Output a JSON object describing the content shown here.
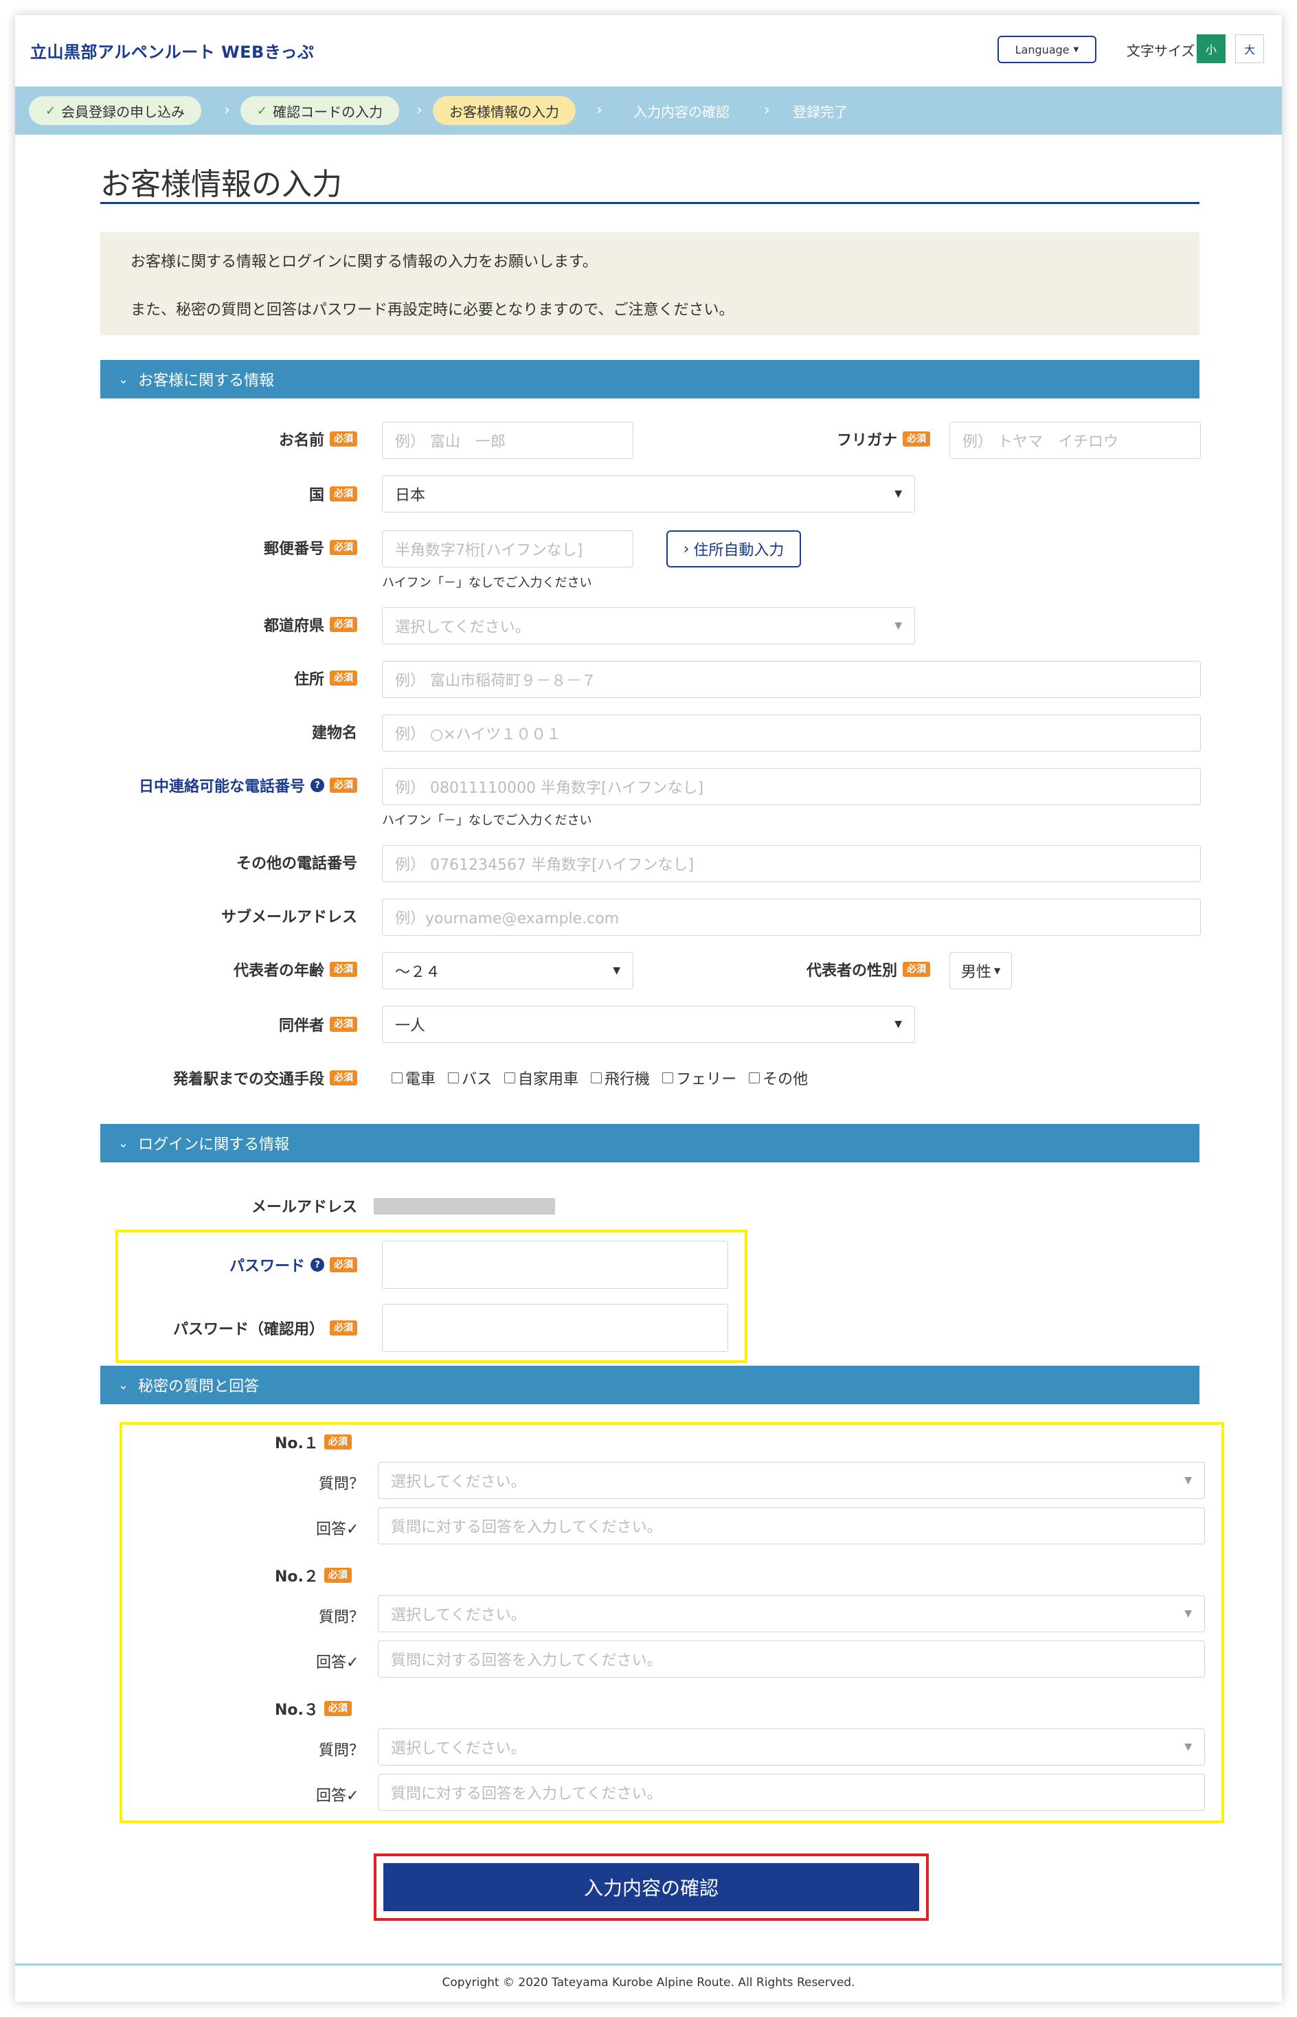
{
  "header": {
    "brand": "立山黒部アルペンルート WEBきっぷ",
    "language": "Language",
    "font_size_label": "文字サイズ",
    "font_small": "小",
    "font_large": "大"
  },
  "steps": [
    {
      "label": "会員登録の申し込み",
      "state": "done"
    },
    {
      "label": "確認コードの入力",
      "state": "done"
    },
    {
      "label": "お客様情報の入力",
      "state": "current"
    },
    {
      "label": "入力内容の確認",
      "state": "todo"
    },
    {
      "label": "登録完了",
      "state": "todo"
    }
  ],
  "page_title": "お客様情報の入力",
  "notice": {
    "line1": "お客様に関する情報とログインに関する情報の入力をお願いします。",
    "line2": "また、秘密の質問と回答はパスワード再設定時に必要となりますので、ご注意ください。"
  },
  "required_badge": "必須",
  "customer_section": {
    "title": "お客様に関する情報",
    "name": {
      "label": "お名前",
      "placeholder": "例） 富山　一郎"
    },
    "furigana": {
      "label": "フリガナ",
      "placeholder": "例） トヤマ　イチロウ"
    },
    "country": {
      "label": "国",
      "value": "日本"
    },
    "postal": {
      "label": "郵便番号",
      "placeholder": "半角数字7桁[ハイフンなし]",
      "button": "住所自動入力",
      "hint": "ハイフン「－」なしでご入力ください"
    },
    "prefecture": {
      "label": "都道府県",
      "placeholder": "選択してください。"
    },
    "address": {
      "label": "住所",
      "placeholder": "例） 富山市稲荷町９－８－７"
    },
    "building": {
      "label": "建物名",
      "placeholder": "例） ○×ハイツ１００１"
    },
    "day_phone": {
      "label": "日中連絡可能な電話番号",
      "placeholder": "例） 08011110000 半角数字[ハイフンなし]",
      "hint": "ハイフン「－」なしでご入力ください"
    },
    "other_phone": {
      "label": "その他の電話番号",
      "placeholder": "例） 0761234567 半角数字[ハイフンなし]"
    },
    "sub_email": {
      "label": "サブメールアドレス",
      "placeholder": "例）yourname@example.com"
    },
    "age": {
      "label": "代表者の年齢",
      "value": "～２４"
    },
    "gender": {
      "label": "代表者の性別",
      "value": "男性"
    },
    "companion": {
      "label": "同伴者",
      "value": "一人"
    },
    "transport": {
      "label": "発着駅までの交通手段",
      "options": [
        "電車",
        "バス",
        "自家用車",
        "飛行機",
        "フェリー",
        "その他"
      ]
    }
  },
  "login_section": {
    "title": "ログインに関する情報",
    "email_label": "メールアドレス",
    "password_label": "パスワード",
    "password_confirm_label": "パスワード（確認用）"
  },
  "secret_section": {
    "title": "秘密の質問と回答",
    "question_label": "質問？",
    "answer_label": "回答✓",
    "question_placeholder": "選択してください。",
    "answer_placeholder": "質問に対する回答を入力してください。",
    "items": [
      "No.１",
      "No.２",
      "No.３"
    ]
  },
  "submit_label": "入力内容の確認",
  "footer": "Copyright © 2020 Tateyama Kurobe Alpine Route. All Rights Reserved.",
  "colors": {
    "navy": "#1b3c8e",
    "section_blue": "#3a8fbf",
    "step_bar": "#a4cfe3",
    "required": "#f08a24",
    "highlight_yellow": "#fff200",
    "highlight_red": "#e51d24"
  }
}
